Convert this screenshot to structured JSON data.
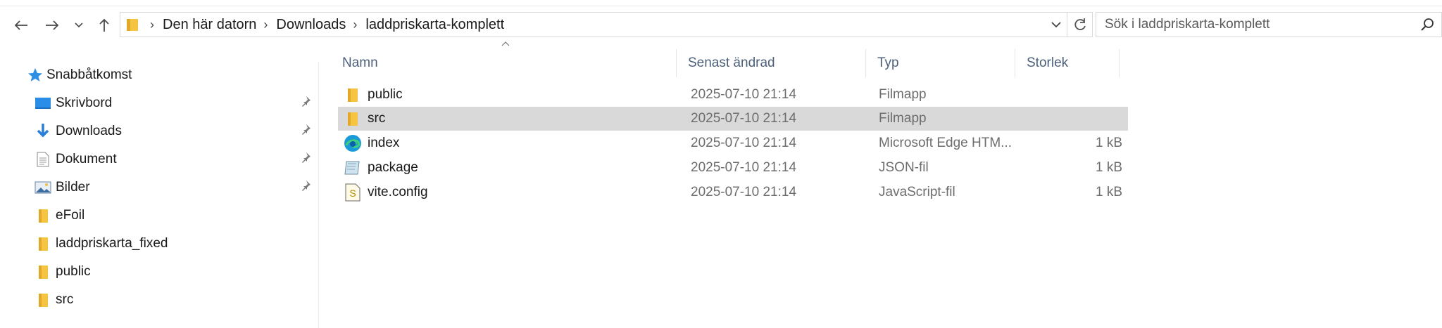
{
  "address": {
    "crumbs": [
      "Den här datorn",
      "Downloads",
      "laddpriskarta-komplett"
    ]
  },
  "search": {
    "placeholder": "Sök i laddpriskarta-komplett"
  },
  "sidebar": {
    "quick_access": "Snabbåtkomst",
    "items": [
      {
        "label": "Skrivbord",
        "icon": "desktop-icon",
        "pinned": true
      },
      {
        "label": "Downloads",
        "icon": "download-icon",
        "pinned": true
      },
      {
        "label": "Dokument",
        "icon": "document-icon",
        "pinned": true
      },
      {
        "label": "Bilder",
        "icon": "pictures-icon",
        "pinned": true
      },
      {
        "label": "eFoil",
        "icon": "folder-icon",
        "pinned": false
      },
      {
        "label": "laddpriskarta_fixed",
        "icon": "folder-icon",
        "pinned": false
      },
      {
        "label": "public",
        "icon": "folder-icon",
        "pinned": false
      },
      {
        "label": "src",
        "icon": "folder-icon",
        "pinned": false
      }
    ]
  },
  "columns": {
    "name": "Namn",
    "date": "Senast ändrad",
    "type": "Typ",
    "size": "Storlek"
  },
  "files": [
    {
      "name": "public",
      "date": "2025-07-10 21:14",
      "type": "Filmapp",
      "size": "",
      "icon": "folder-icon",
      "selected": false
    },
    {
      "name": "src",
      "date": "2025-07-10 21:14",
      "type": "Filmapp",
      "size": "",
      "icon": "folder-icon",
      "selected": true
    },
    {
      "name": "index",
      "date": "2025-07-10 21:14",
      "type": "Microsoft Edge HTM...",
      "size": "1 kB",
      "icon": "edge-icon",
      "selected": false
    },
    {
      "name": "package",
      "date": "2025-07-10 21:14",
      "type": "JSON-fil",
      "size": "1 kB",
      "icon": "json-file-icon",
      "selected": false
    },
    {
      "name": "vite.config",
      "date": "2025-07-10 21:14",
      "type": "JavaScript-fil",
      "size": "1 kB",
      "icon": "js-file-icon",
      "selected": false
    }
  ],
  "colors": {
    "selection": "#d9d9d9",
    "header_text": "#4c607a",
    "folder": "#f5c542"
  }
}
